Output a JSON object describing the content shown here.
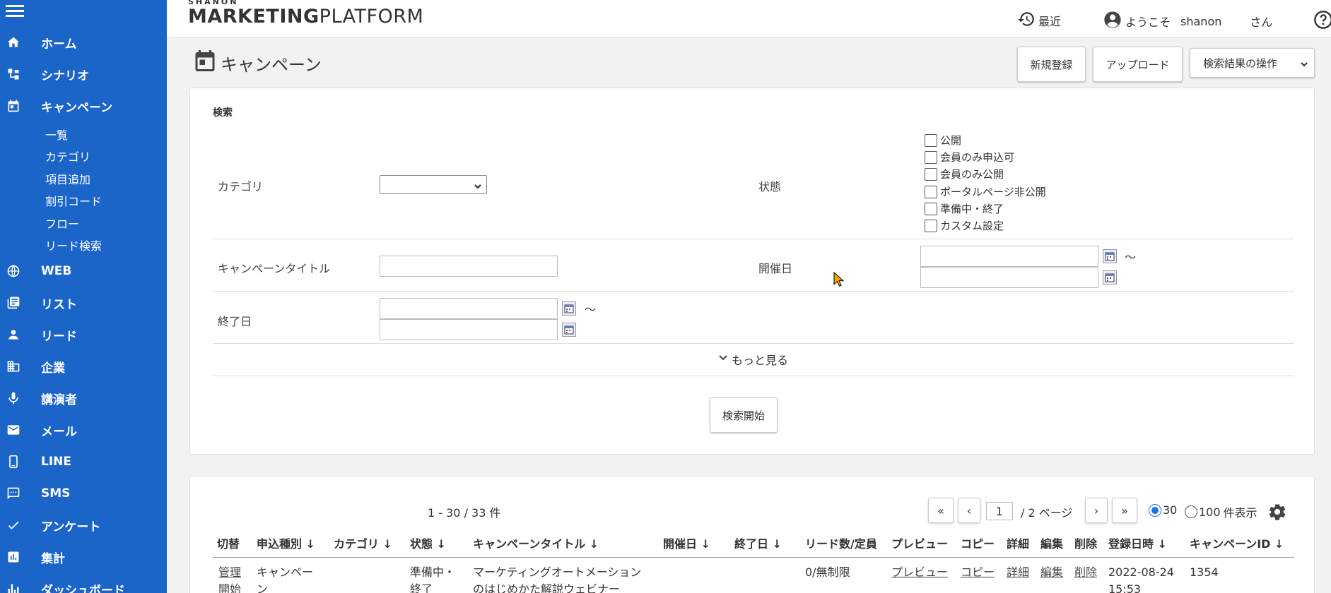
{
  "header": {
    "logo_small": "SHANON",
    "logo_marketing": "MARKETING",
    "logo_platform": "PLATFORM",
    "recent": "最近",
    "welcome": "ようこそ",
    "user_name": "shanon",
    "honorific": "さん"
  },
  "sidebar": {
    "items": [
      {
        "label": "ホーム",
        "icon": "home-icon"
      },
      {
        "label": "シナリオ",
        "icon": "scenario-icon"
      },
      {
        "label": "キャンペーン",
        "icon": "calendar-icon"
      },
      {
        "label": "WEB",
        "icon": "globe-icon"
      },
      {
        "label": "リスト",
        "icon": "list-icon"
      },
      {
        "label": "リード",
        "icon": "person-icon"
      },
      {
        "label": "企業",
        "icon": "building-icon"
      },
      {
        "label": "講演者",
        "icon": "mic-icon"
      },
      {
        "label": "メール",
        "icon": "mail-icon"
      },
      {
        "label": "LINE",
        "icon": "phone-icon"
      },
      {
        "label": "SMS",
        "icon": "sms-icon"
      },
      {
        "label": "アンケート",
        "icon": "check-icon"
      },
      {
        "label": "集計",
        "icon": "chart-icon"
      },
      {
        "label": "ダッシュボード",
        "icon": "dashboard-icon"
      }
    ],
    "sub_items": [
      "一覧",
      "カテゴリ",
      "項目追加",
      "割引コード",
      "フロー",
      "リード検索"
    ]
  },
  "page": {
    "title": "キャンペーン",
    "new_button": "新規登録",
    "upload_button": "アップロード",
    "ops_select": "検索結果の操作"
  },
  "search": {
    "heading": "検索",
    "category_label": "カテゴリ",
    "status_label": "状態",
    "status_options": [
      "公開",
      "会員のみ申込可",
      "会員のみ公開",
      "ポータルページ非公開",
      "準備中・終了",
      "カスタム設定"
    ],
    "title_label": "キャンペーンタイトル",
    "event_date_label": "開催日",
    "end_date_label": "終了日",
    "tilde": "～",
    "more": "もっと見る",
    "start_button": "検索開始"
  },
  "results": {
    "count": "1 - 30 / 33 件",
    "first": "«",
    "prev": "‹",
    "page": "1",
    "total_pages": "/ 2 ページ",
    "next": "›",
    "last": "»",
    "per_page_30": "30",
    "per_page_100": "100",
    "per_page_suffix": "件表示",
    "columns": {
      "switch": "切替",
      "type": "申込種別 ↓",
      "category": "カテゴリ ↓",
      "status": "状態 ↓",
      "title": "キャンペーンタイトル ↓",
      "event_date": "開催日 ↓",
      "end_date": "終了日 ↓",
      "leads": "リード数/定員",
      "preview": "プレビュー",
      "copy": "コピー",
      "detail": "詳細",
      "edit": "編集",
      "delete": "削除",
      "registered": "登録日時 ↓",
      "campaign_id": "キャンペーンID ↓"
    },
    "row1": {
      "switch_1": "管理",
      "switch_2": "開始",
      "type_1": "キャンペー",
      "type_2": "ン",
      "status_1": "準備中・",
      "status_2": "終了",
      "title_1": "マーケティングオートメーション",
      "title_2": "のはじめかた解説ウェビナー",
      "leads": "0/無制限",
      "preview": "プレビュー",
      "copy": "コピー",
      "detail": "詳細",
      "edit": "編集",
      "delete": "削除",
      "registered_1": "2022-08-24",
      "registered_2": "15:53",
      "campaign_id": "1354"
    }
  },
  "colors": {
    "sidebar": "#1b64c8",
    "accent": "#1a73e8"
  }
}
